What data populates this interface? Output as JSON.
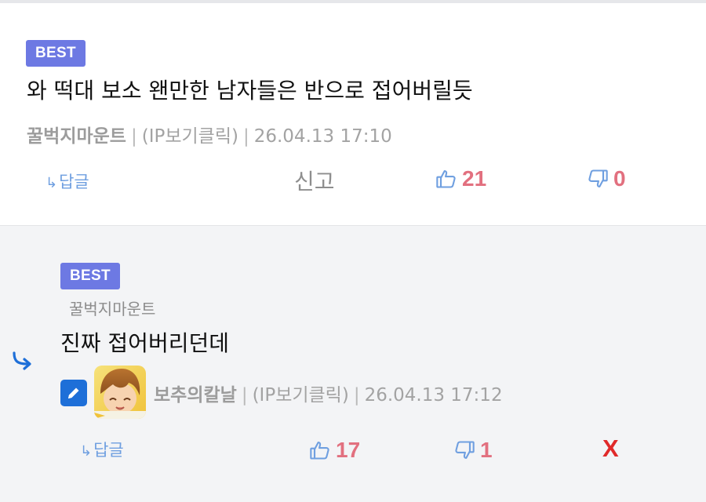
{
  "comments": [
    {
      "badge": "BEST",
      "text": "와 떡대 보소 왠만한 남자들은 반으로 접어버릴듯",
      "author": "꿀벅지마운트",
      "ip": "(IP보기클릭)",
      "timestamp": "26.04.13 17:10",
      "reply_label": "답글",
      "report_label": "신고",
      "upvotes": "21",
      "downvotes": "0"
    },
    {
      "badge": "BEST",
      "reply_to": "꿀벅지마운트",
      "text": "진짜 접어버리던데",
      "author": "보추의칼날",
      "ip": "(IP보기클릭)",
      "timestamp": "26.04.13 17:12",
      "reply_label": "답글",
      "upvotes": "17",
      "downvotes": "1",
      "delete_label": "X"
    }
  ],
  "separator": "|",
  "colors": {
    "badge_bg": "#6d79e3",
    "vote_count": "#e2707f",
    "reply_link": "#6f9fe0",
    "vote_icon": "#6f9fe0",
    "delete": "#e02a2a",
    "edit_icon_bg": "#1e6fd8",
    "reply_bg": "#f3f4f6"
  },
  "icons": {
    "reply_arrow": "reply-arrow-icon",
    "thumbs_up": "thumbs-up-icon",
    "thumbs_down": "thumbs-down-icon",
    "edit": "pencil-icon",
    "reply_indicator": "curved-arrow-icon"
  }
}
